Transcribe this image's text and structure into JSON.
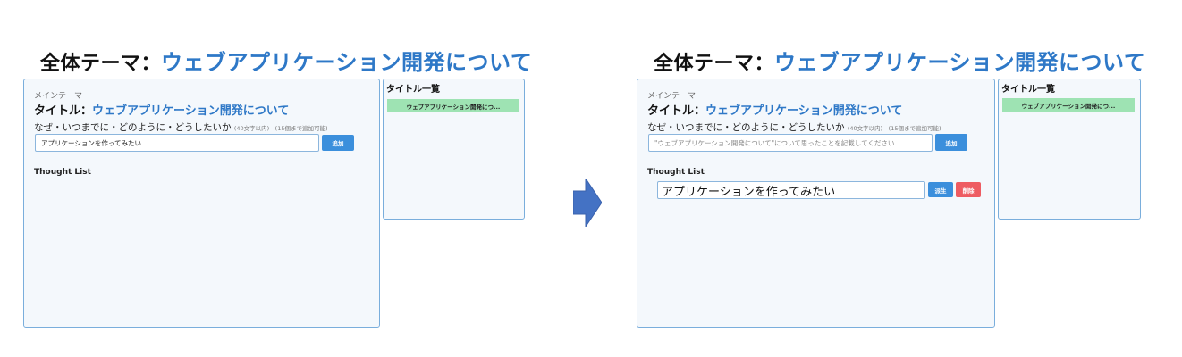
{
  "heading": {
    "prefix": "全体テーマ：",
    "theme": "ウェブアプリケーション開発について"
  },
  "before": {
    "main_label": "メインテーマ",
    "title_prefix": "タイトル：",
    "title_value": "ウェブアプリケーション開発について",
    "question": "なぜ・いつまでに・どのように・どうしたいか",
    "question_note": "(40文字以内)　(15個まで追加可能)",
    "input_value": "アプリケーションを作ってみたい",
    "add_button": "追加",
    "thought_list_label": "Thought List",
    "sidebar_title": "タイトル一覧",
    "sidebar_items": [
      "ウェブアプリケーション開発につ..."
    ]
  },
  "after": {
    "main_label": "メインテーマ",
    "title_prefix": "タイトル：",
    "title_value": "ウェブアプリケーション開発について",
    "question": "なぜ・いつまでに・どのように・どうしたいか",
    "question_note": "(40文字以内)　(15個まで追加可能)",
    "input_placeholder": "\"ウェブアプリケーション開発について\"について思ったことを記載してください",
    "add_button": "追加",
    "thought_list_label": "Thought List",
    "thoughts": [
      {
        "text": "アプリケーションを作ってみたい",
        "derive_button": "派生",
        "delete_button": "削除"
      }
    ],
    "sidebar_title": "タイトル一覧",
    "sidebar_items": [
      "ウェブアプリケーション開発につ..."
    ]
  },
  "colors": {
    "accent": "#2e78c7",
    "button_blue": "#3b8fdc",
    "button_red": "#ee5c62",
    "sidebar_item_bg": "#9ee3b3",
    "panel_border": "#7aaedc",
    "arrow": "#4472c4"
  },
  "icons": {
    "transition_arrow": "right-arrow-icon"
  }
}
